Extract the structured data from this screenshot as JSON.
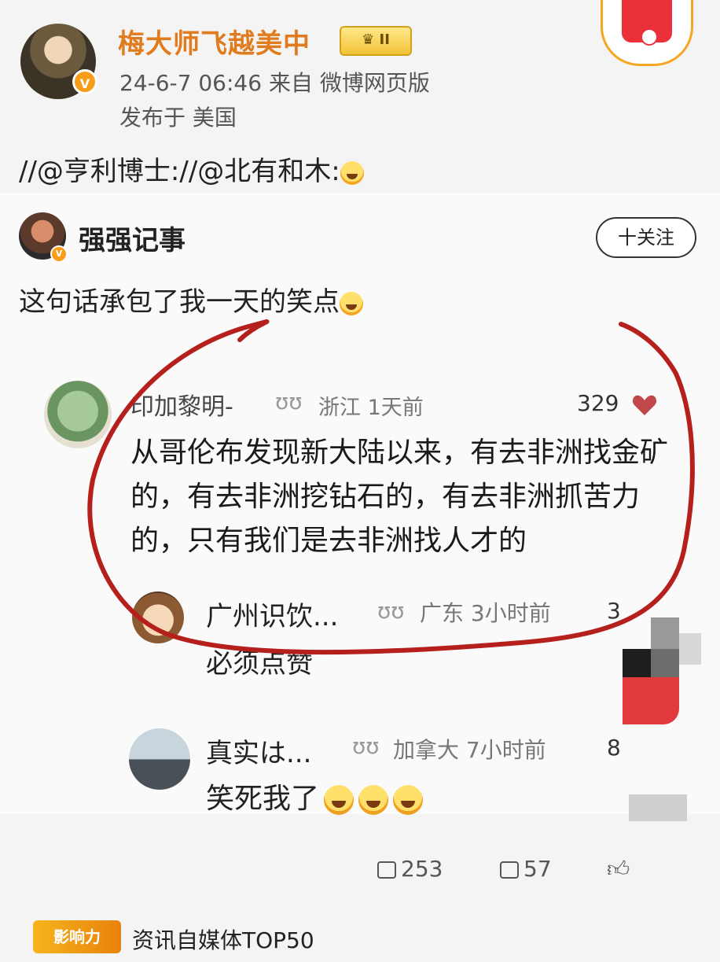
{
  "post": {
    "author": "梅大师飞越美中",
    "level_badge": "II",
    "verified_badge": "V",
    "time_source": "24-6-7 06:46  来自 微博网页版",
    "location": "发布于 美国",
    "repost_text": "//@亨利博士://@北有和木:"
  },
  "quoted": {
    "name": "强强记事",
    "follow_label": "十关注",
    "text": "这句话承包了我一天的笑点",
    "comments": [
      {
        "name": "印加黎明-",
        "tag": "ʊʊ",
        "location": "浙江  1天前",
        "likes": "329",
        "text": "从哥伦布发现新大陆以来，有去非洲找金矿的，有去非洲挖钻石的，有去非洲抓苦力的，只有我们是去非洲找人才的"
      },
      {
        "name": "广州识饮...",
        "tag": "ʊʊ",
        "location": "广东  3小时前",
        "likes": "3",
        "text": "必须点赞"
      },
      {
        "name": "真实は...",
        "tag": "ʊʊ",
        "location": "加拿大  7小时前",
        "likes": "8",
        "text": "笑死我了"
      }
    ]
  },
  "actions": {
    "share_count": "253",
    "comment_count": "57"
  },
  "footer": {
    "influence_badge": "影响力",
    "influence_text": "资讯自媒体TOP50"
  },
  "colors": {
    "author": "#e07b1e",
    "circle": "#b5201c",
    "heart": "#c2474a"
  }
}
